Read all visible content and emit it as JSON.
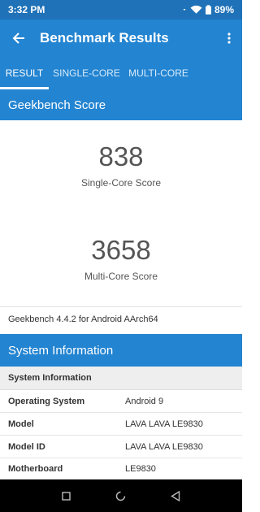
{
  "status_bar": {
    "time": "3:32 PM",
    "battery": "89%"
  },
  "app_bar": {
    "title": "Benchmark Results"
  },
  "tabs": [
    {
      "label": "RESULT",
      "active": true
    },
    {
      "label": "SINGLE-CORE",
      "active": false
    },
    {
      "label": "MULTI-CORE",
      "active": false
    }
  ],
  "geekbench_section": {
    "title": "Geekbench Score"
  },
  "scores": {
    "single": {
      "value": "838",
      "label": "Single-Core Score"
    },
    "multi": {
      "value": "3658",
      "label": "Multi-Core Score"
    }
  },
  "version_text": "Geekbench 4.4.2 for Android AArch64",
  "system_section": {
    "title": "System Information"
  },
  "system_info": {
    "subheader": "System Information",
    "rows": [
      {
        "key": "Operating System",
        "value": "Android 9"
      },
      {
        "key": "Model",
        "value": "LAVA LAVA LE9830"
      },
      {
        "key": "Model ID",
        "value": "LAVA LAVA LE9830"
      },
      {
        "key": "Motherboard",
        "value": "LE9830"
      }
    ]
  },
  "colors": {
    "status_bar": "#1f72b8",
    "primary": "#2384d1",
    "subheader_bg": "#eeeeee"
  }
}
